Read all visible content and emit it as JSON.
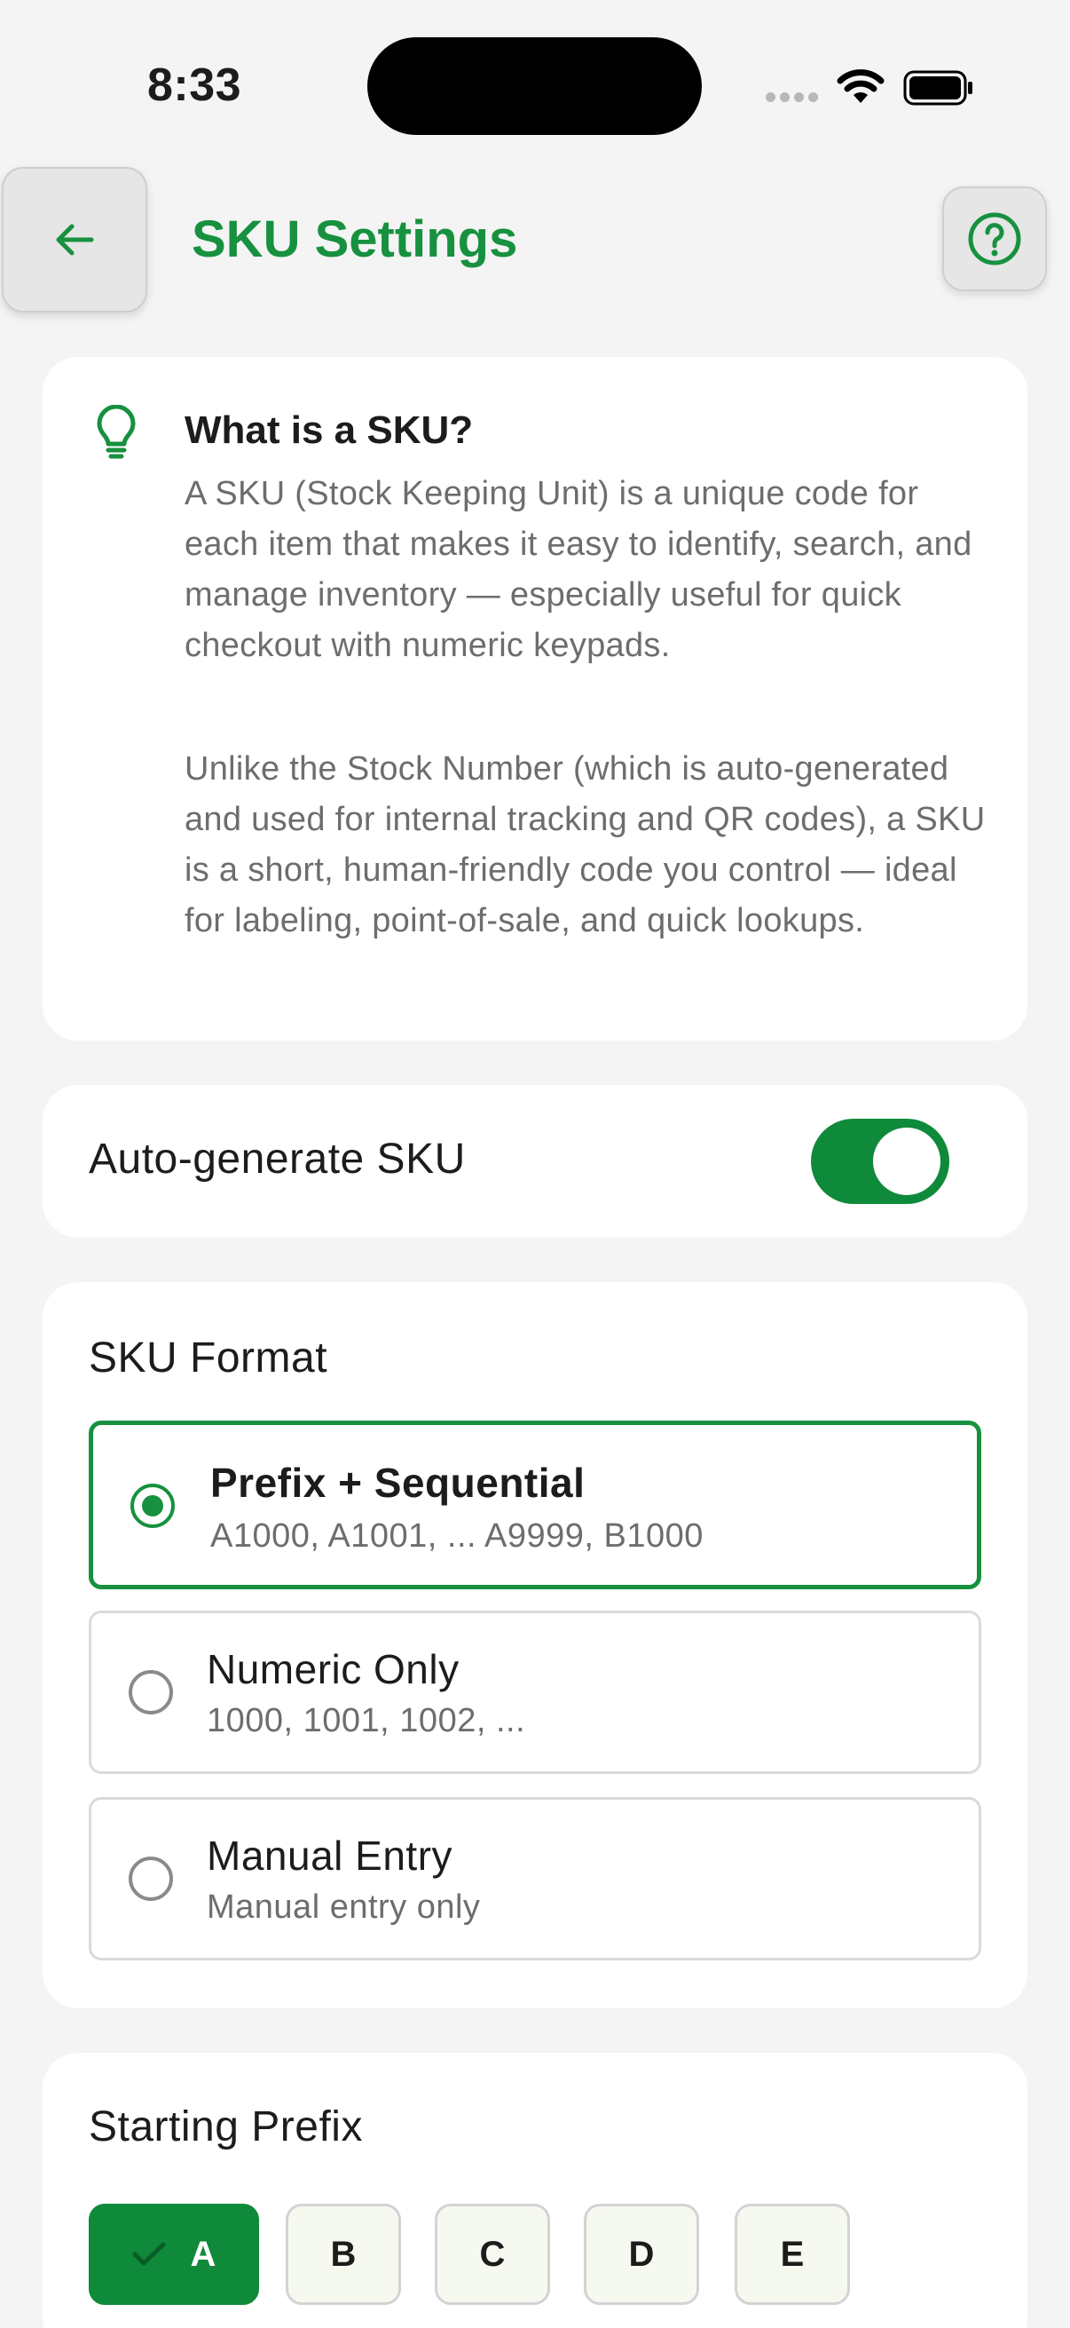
{
  "status_bar": {
    "time": "8:33"
  },
  "header": {
    "title": "SKU Settings"
  },
  "info": {
    "title": "What is a SKU?",
    "paragraph1": "A SKU (Stock Keeping Unit) is a unique code for each item that makes it easy to identify, search, and manage inventory — especially useful for quick checkout with numeric keypads.",
    "paragraph2": "Unlike the Stock Number (which is auto-generated and used for internal tracking and QR codes), a SKU is a short, human-friendly code you control — ideal for labeling, point-of-sale, and quick lookups."
  },
  "auto_generate": {
    "label": "Auto-generate SKU",
    "enabled": true
  },
  "format": {
    "title": "SKU Format",
    "selected": "Prefix + Sequential",
    "options": [
      {
        "label": "Prefix + Sequential",
        "description": "A1000, A1001, ... A9999, B1000"
      },
      {
        "label": "Numeric Only",
        "description": "1000, 1001, 1002, ..."
      },
      {
        "label": "Manual Entry",
        "description": "Manual entry only"
      }
    ]
  },
  "prefix": {
    "title": "Starting Prefix",
    "selected": "A",
    "options": [
      "A",
      "B",
      "C",
      "D",
      "E"
    ]
  },
  "colors": {
    "accent": "#17913f",
    "toggle_on": "#0f8a3a"
  }
}
